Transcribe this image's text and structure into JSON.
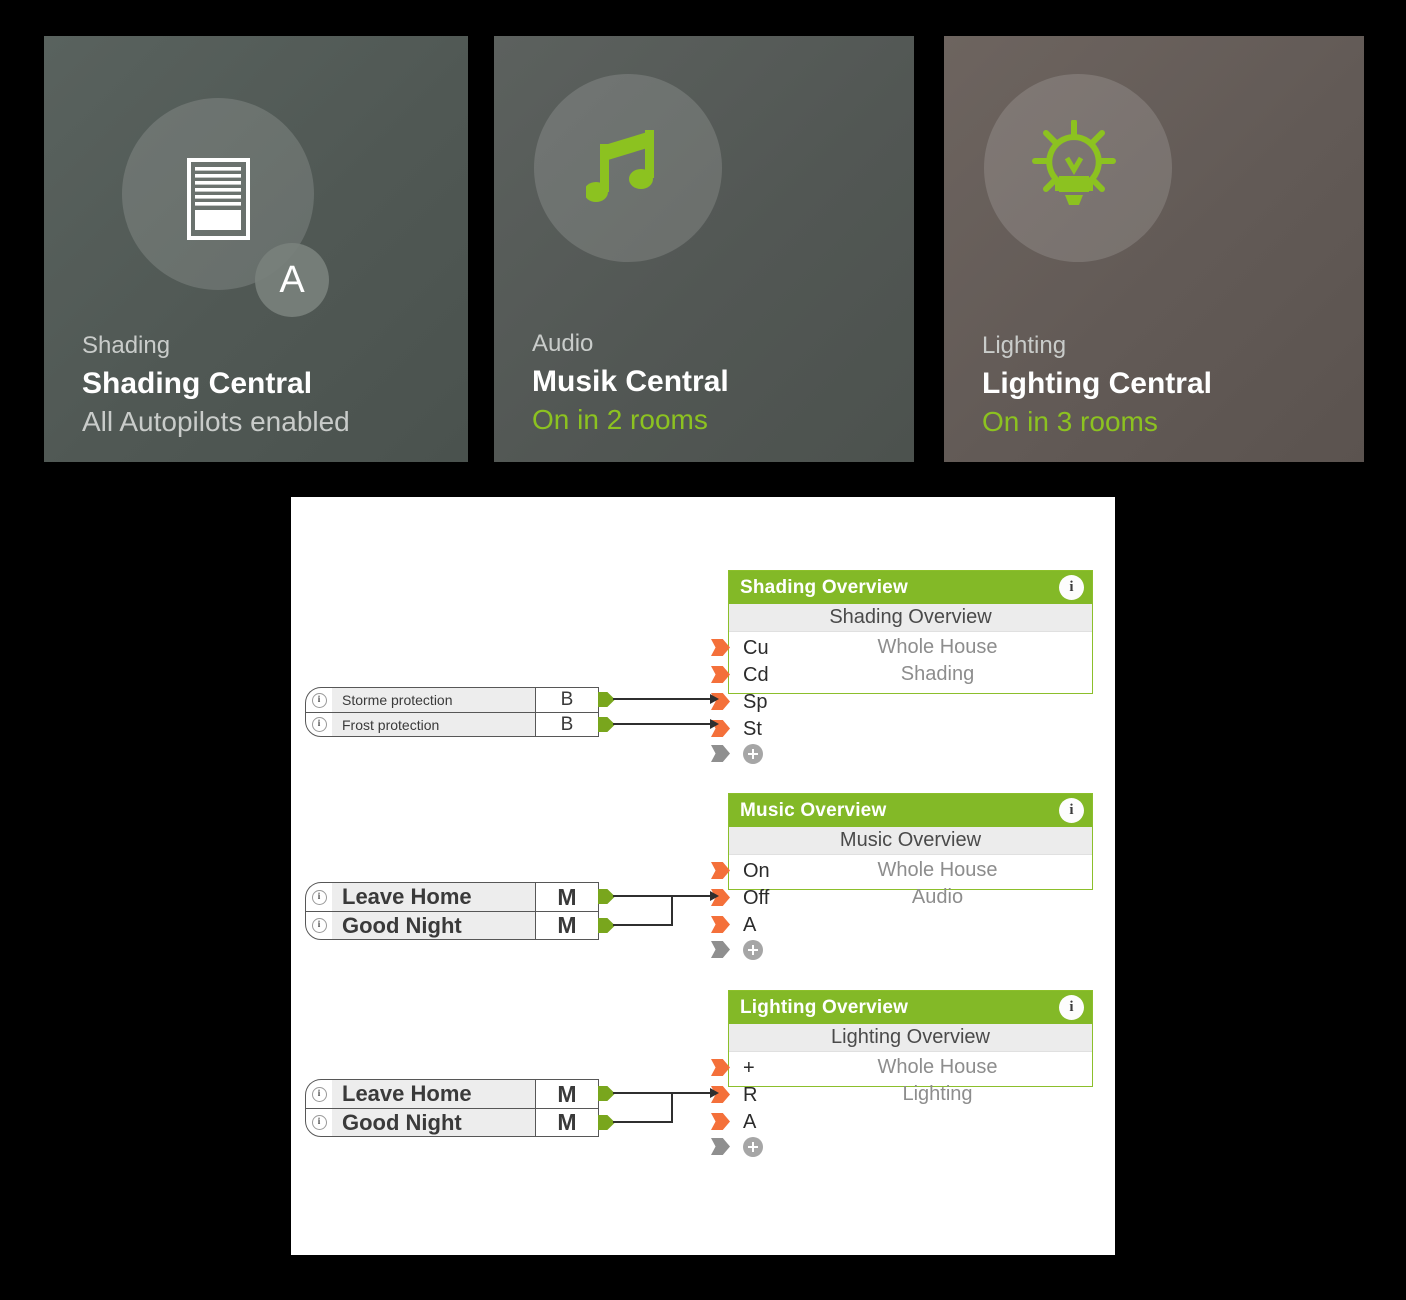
{
  "cards": [
    {
      "category": "Shading",
      "title": "Shading Central",
      "status": "All Autopilots enabled",
      "status_color": "#c9ccca",
      "icon": "blinds-icon",
      "icon_color": "#ffffff",
      "badge": "A",
      "has_badge": true,
      "bg_from": "#56605c",
      "bg_to": "#4c5450"
    },
    {
      "category": "Audio",
      "title": "Musik Central",
      "status": "On in 2 rooms",
      "status_color": "#8cc220",
      "icon": "music-note-icon",
      "icon_color": "#8cc220",
      "badge": "",
      "has_badge": false,
      "bg_from": "#5a5f5c",
      "bg_to": "#4e5350"
    },
    {
      "category": "Lighting",
      "title": "Lighting Central",
      "status": "On in 3 rooms",
      "status_color": "#8cc220",
      "icon": "light-bulb-icon",
      "icon_color": "#8cc220",
      "badge": "",
      "has_badge": false,
      "bg_from": "#6b625e",
      "bg_to": "#5e5652"
    }
  ],
  "diagram": {
    "accent_green": "#83b927",
    "pin_orange": "#f4703a",
    "blocks": [
      {
        "header": "Shading Overview",
        "subtitle": "Shading Overview",
        "value_lines": [
          "Whole House",
          "Shading"
        ],
        "inputs": [
          "Cu",
          "Cd",
          "Sp",
          "St"
        ],
        "add_row": "+",
        "info": "i"
      },
      {
        "header": "Music Overview",
        "subtitle": "Music Overview",
        "value_lines": [
          "Whole House",
          "Audio"
        ],
        "inputs": [
          "On",
          "Off",
          "A"
        ],
        "add_row": "+",
        "info": "i"
      },
      {
        "header": "Lighting Overview",
        "subtitle": "Lighting Overview",
        "value_lines": [
          "Whole House",
          "Lighting"
        ],
        "inputs": [
          "+",
          "R",
          "A"
        ],
        "add_row": "+",
        "info": "i"
      }
    ],
    "node_groups": [
      {
        "size": "small",
        "nodes": [
          {
            "label": "Storme protection",
            "type": "B",
            "info": "i"
          },
          {
            "label": "Frost protection",
            "type": "B",
            "info": "i"
          }
        ]
      },
      {
        "size": "big",
        "nodes": [
          {
            "label": "Leave Home",
            "type": "M",
            "info": "i"
          },
          {
            "label": "Good Night",
            "type": "M",
            "info": "i"
          }
        ]
      },
      {
        "size": "big",
        "nodes": [
          {
            "label": "Leave Home",
            "type": "M",
            "info": "i"
          },
          {
            "label": "Good Night",
            "type": "M",
            "info": "i"
          }
        ]
      }
    ]
  }
}
